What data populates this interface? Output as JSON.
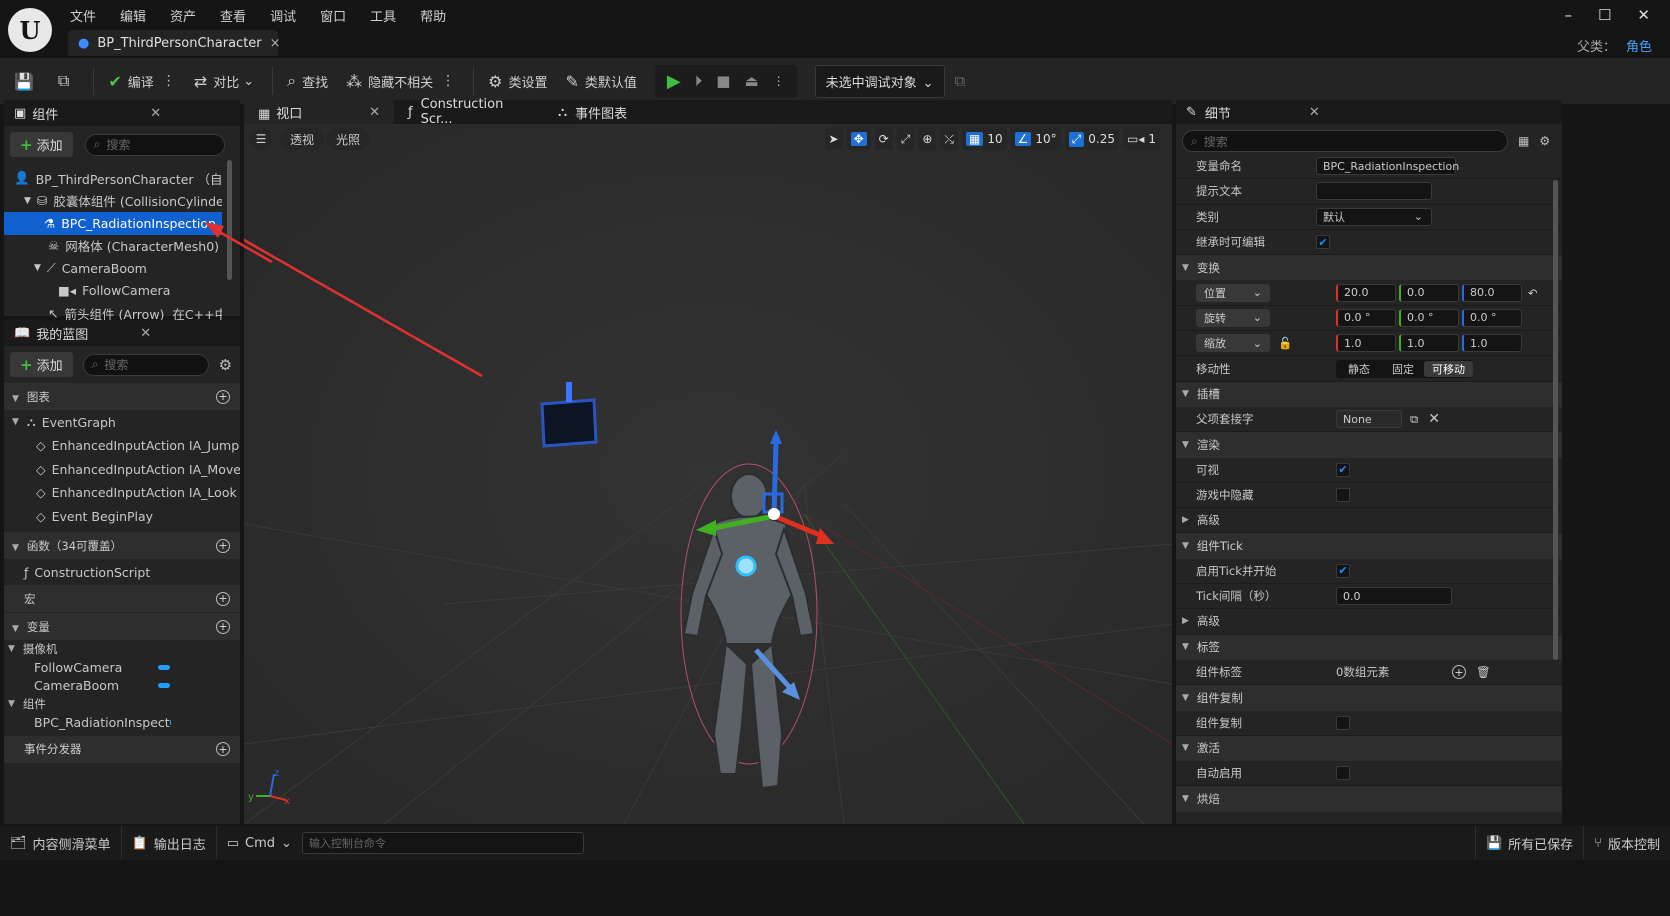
{
  "menu": [
    "文件",
    "编辑",
    "资产",
    "查看",
    "调试",
    "窗口",
    "工具",
    "帮助"
  ],
  "document_tab": {
    "label": "BP_ThirdPersonCharacter",
    "close": "×"
  },
  "window_controls": {
    "minimize": "–",
    "maximize": "☐",
    "close": "✕"
  },
  "parent_class": {
    "label": "父类：",
    "value": "角色"
  },
  "toolbar": {
    "compile": "编译",
    "diff": "对比",
    "find": "查找",
    "hide_unrelated": "隐藏不相关",
    "class_settings": "类设置",
    "class_defaults": "类默认值",
    "debug_object": "未选中调试对象"
  },
  "components_panel": {
    "title": "组件",
    "add": "添加",
    "search_placeholder": "搜索",
    "tree": [
      {
        "label": "BP_ThirdPersonCharacter （自身）",
        "indent": 0
      },
      {
        "label": "胶囊体组件 (CollisionCylinder)",
        "indent": 1
      },
      {
        "label": "BPC_RadiationInspection",
        "indent": 2,
        "selected": true
      },
      {
        "label": "网格体 (CharacterMesh0)",
        "indent": 2
      },
      {
        "label": "CameraBoom",
        "indent": 2
      },
      {
        "label": "FollowCamera",
        "indent": 3
      },
      {
        "label": "箭头组件 (Arrow)",
        "indent": 2,
        "suffix": "在C++中编辑"
      }
    ]
  },
  "my_blueprint": {
    "title": "我的蓝图",
    "add": "添加",
    "search_placeholder": "搜索",
    "graphs_label": "图表",
    "event_graph": "EventGraph",
    "events": [
      "EnhancedInputAction IA_Jump",
      "EnhancedInputAction IA_Move",
      "EnhancedInputAction IA_Look",
      "Event BeginPlay"
    ],
    "functions_label": "函数（34可覆盖）",
    "functions": [
      "ConstructionScript"
    ],
    "macros_label": "宏",
    "variables_label": "变量",
    "var_cat_camera": "摄像机",
    "vars_camera": [
      "FollowCamera",
      "CameraBoom"
    ],
    "var_cat_components": "组件",
    "vars_components": [
      "BPC_RadiationInspect"
    ],
    "dispatchers_label": "事件分发器"
  },
  "viewport_tabs": [
    "视口",
    "Construction Scr...",
    "事件图表"
  ],
  "viewport": {
    "perspective": "透视",
    "lighting": "光照",
    "grid_snap": "10",
    "rot_snap": "10°",
    "scale_snap": "0.25",
    "cam_speed": "1"
  },
  "details": {
    "title": "细节",
    "search_placeholder": "搜索",
    "variable_name_label": "变量命名",
    "variable_name": "BPC_RadiationInspection",
    "tooltip_label": "提示文本",
    "category_label": "类别",
    "category": "默认",
    "editable_label": "继承时可编辑",
    "transform": "变换",
    "location": "位置",
    "loc": [
      "20.0",
      "0.0",
      "80.0"
    ],
    "rotation": "旋转",
    "rot": [
      "0.0 °",
      "0.0 °",
      "0.0 °"
    ],
    "scale": "缩放",
    "scl": [
      "1.0",
      "1.0",
      "1.0"
    ],
    "mobility": "移动性",
    "mob_opts": [
      "静态",
      "固定",
      "可移动"
    ],
    "sockets": "插槽",
    "parent_socket": "父项套接字",
    "parent_socket_val": "None",
    "rendering": "渲染",
    "visible": "可视",
    "hidden_in_game": "游戏中隐藏",
    "advanced": "高级",
    "component_tick": "组件Tick",
    "start_tick": "启用Tick并开始",
    "tick_interval": "Tick间隔（秒）",
    "tick_interval_val": "0.0",
    "tags": "标签",
    "component_tags": "组件标签",
    "component_tags_val": "0数组元素",
    "replication": "组件复制",
    "replicate": "组件复制",
    "activation": "激活",
    "auto_activate": "自动启用",
    "cooking": "烘焙"
  },
  "statusbar": {
    "content_drawer": "内容侧滑菜单",
    "output_log": "输出日志",
    "cmd": "Cmd",
    "console_placeholder": "输入控制台命令",
    "saved": "所有已保存",
    "source_control": "版本控制"
  },
  "colors": {
    "accent": "#1e6fd6",
    "selected": "#1060d0",
    "x_axis": "#e03020",
    "y_axis": "#40b020",
    "z_axis": "#2a6ae0",
    "arrow": "#e03030"
  }
}
